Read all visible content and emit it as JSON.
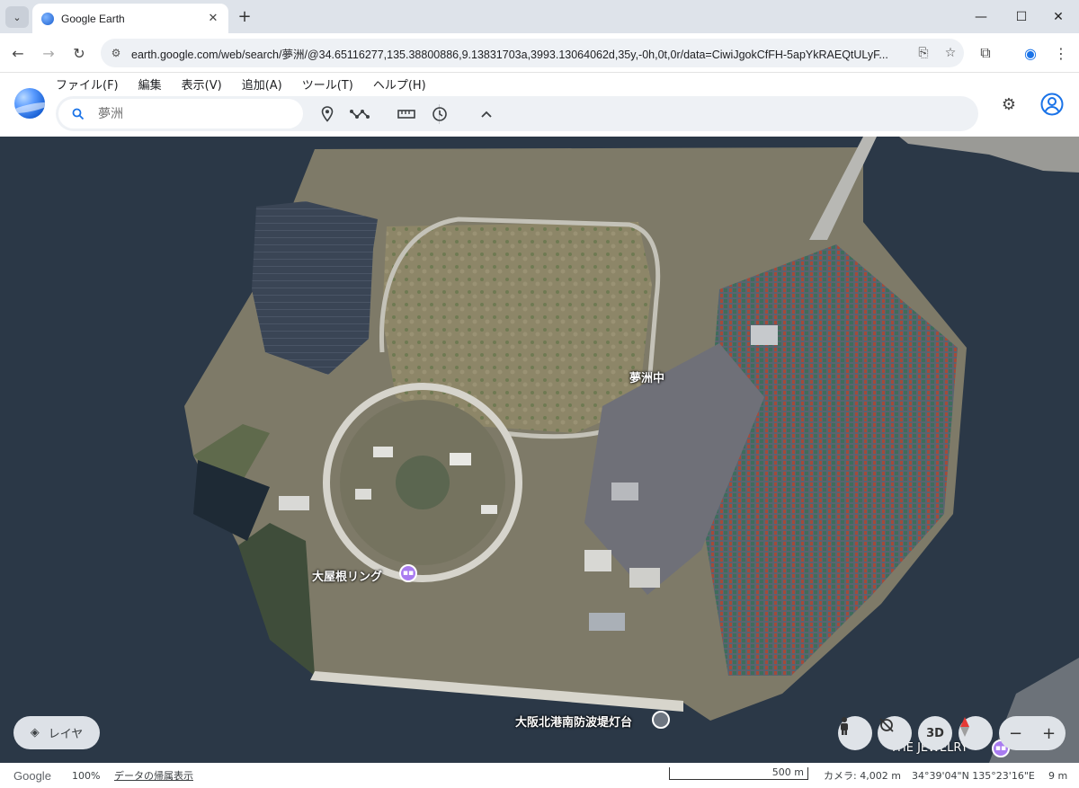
{
  "browser": {
    "tab_title": "Google Earth",
    "url": "earth.google.com/web/search/夢洲/@34.65116277,135.38800886,9.13831703a,3993.13064062d,35y,-0h,0t,0r/data=CiwiJgokCfFH-5apYkRAEQtULyF..."
  },
  "menu": [
    "ファイル(F)",
    "編集",
    "表示(V)",
    "追加(A)",
    "ツール(T)",
    "ヘルプ(H)"
  ],
  "search": {
    "placeholder": "夢洲"
  },
  "map": {
    "labels": {
      "yumeshima_naka": "夢洲中",
      "oyane_ring": "大屋根リング",
      "lighthouse": "大阪北港南防波堤灯台",
      "jewelry": "THE JEWELRY"
    },
    "layer_button": "レイヤ",
    "btn_3d": "3D"
  },
  "status": {
    "logo": "Google",
    "zoom": "100%",
    "attribution": "データの帰属表示",
    "scale": "500 m",
    "camera": "カメラ: 4,002 m",
    "coords": "34°39'04\"N 135°23'16\"E",
    "elevation": "9 m"
  }
}
